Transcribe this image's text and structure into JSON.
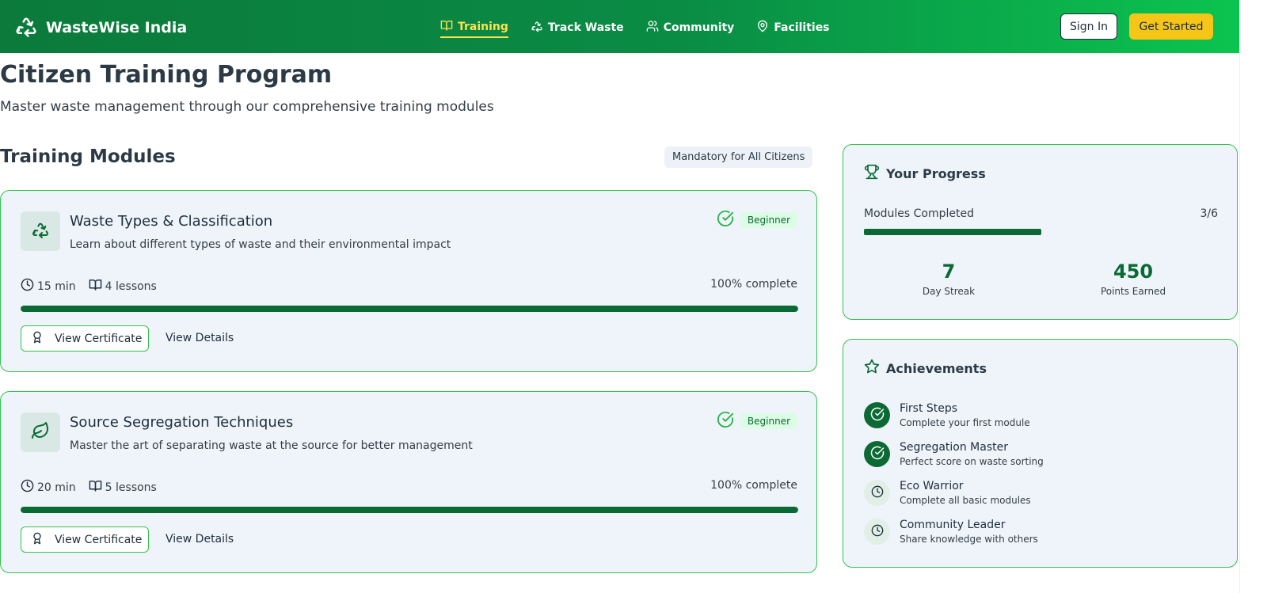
{
  "header": {
    "brand": "WasteWise India",
    "nav": [
      {
        "label": "Training",
        "icon": "book-icon",
        "active": true
      },
      {
        "label": "Track Waste",
        "icon": "recycle-icon",
        "active": false
      },
      {
        "label": "Community",
        "icon": "users-icon",
        "active": false
      },
      {
        "label": "Facilities",
        "icon": "map-pin-icon",
        "active": false
      }
    ],
    "sign_in": "Sign In",
    "get_started": "Get Started"
  },
  "page": {
    "title": "Citizen Training Program",
    "subtitle": "Master waste management through our comprehensive training modules"
  },
  "modules_section": {
    "title": "Training Modules",
    "badge": "Mandatory for All Citizens"
  },
  "modules": [
    {
      "title": "Waste Types & Classification",
      "description": "Learn about different types of waste and their environmental impact",
      "level": "Beginner",
      "duration": "15 min",
      "lessons": "4 lessons",
      "percent_label": "100% complete",
      "progress": 1.0,
      "cert_label": "View Certificate",
      "details_label": "View Details",
      "icon": "recycle-icon"
    },
    {
      "title": "Source Segregation Techniques",
      "description": "Master the art of separating waste at the source for better management",
      "level": "Beginner",
      "duration": "20 min",
      "lessons": "5 lessons",
      "percent_label": "100% complete",
      "progress": 1.0,
      "cert_label": "View Certificate",
      "details_label": "View Details",
      "icon": "leaf-icon"
    }
  ],
  "progress_card": {
    "title": "Your Progress",
    "modules_label": "Modules Completed",
    "modules_count": "3/6",
    "progress": 0.5,
    "streak_value": "7",
    "streak_label": "Day Streak",
    "points_value": "450",
    "points_label": "Points Earned"
  },
  "achievements_card": {
    "title": "Achievements",
    "items": [
      {
        "title": "First Steps",
        "desc": "Complete your first module",
        "done": true
      },
      {
        "title": "Segregation Master",
        "desc": "Perfect score on waste sorting",
        "done": true
      },
      {
        "title": "Eco Warrior",
        "desc": "Complete all basic modules",
        "done": false
      },
      {
        "title": "Community Leader",
        "desc": "Share knowledge with others",
        "done": false
      }
    ]
  },
  "colors": {
    "brand_green": "#0b6a34",
    "accent_yellow": "#f5c518",
    "card_border": "#35c24f",
    "card_bg": "#eff4fa"
  }
}
